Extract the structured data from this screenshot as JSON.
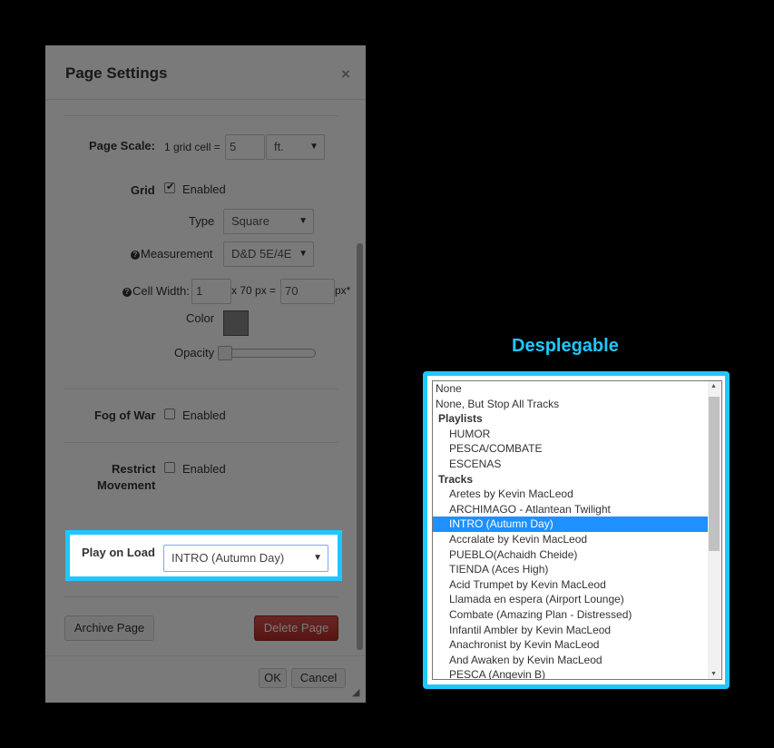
{
  "dialog": {
    "title": "Page Settings",
    "close": "×",
    "page_scale": {
      "label": "Page Scale:",
      "prefix": "1 grid cell =",
      "value": "5",
      "unit": "ft."
    },
    "grid": {
      "label": "Grid",
      "enabled_label": "Enabled",
      "enabled": true
    },
    "type": {
      "label": "Type",
      "value": "Square"
    },
    "measurement": {
      "label": "Measurement",
      "value": "D&D 5E/4E"
    },
    "cell_width": {
      "label": "Cell Width:",
      "value": "1",
      "mid": "x 70 px =",
      "px_value": "70",
      "unit": "px*"
    },
    "color": {
      "label": "Color",
      "value": "#888888"
    },
    "opacity": {
      "label": "Opacity",
      "level": 0.0
    },
    "fog_of_war": {
      "label": "Fog of War",
      "enabled_label": "Enabled",
      "enabled": false
    },
    "restrict_movement": {
      "label_1": "Restrict",
      "label_2": "Movement",
      "enabled_label": "Enabled",
      "enabled": false
    },
    "play_on_load": {
      "label": "Play on Load",
      "value": "INTRO (Autumn Day)"
    },
    "archive_button": "Archive Page",
    "delete_button": "Delete Page",
    "ok_button": "OK",
    "cancel_button": "Cancel"
  },
  "dropdown": {
    "heading": "Desplegable",
    "options": [
      {
        "label": "None",
        "kind": "option"
      },
      {
        "label": "None, But Stop All Tracks",
        "kind": "option"
      },
      {
        "label": "Playlists",
        "kind": "group"
      },
      {
        "label": "HUMOR",
        "kind": "item"
      },
      {
        "label": "PESCA/COMBATE",
        "kind": "item"
      },
      {
        "label": "ESCENAS",
        "kind": "item"
      },
      {
        "label": "Tracks",
        "kind": "group"
      },
      {
        "label": "Aretes by Kevin MacLeod",
        "kind": "item"
      },
      {
        "label": "ARCHIMAGO - Atlantean Twilight",
        "kind": "item"
      },
      {
        "label": "INTRO (Autumn Day)",
        "kind": "item",
        "selected": true
      },
      {
        "label": "Accralate by Kevin MacLeod",
        "kind": "item"
      },
      {
        "label": "PUEBLO(Achaidh Cheide)",
        "kind": "item"
      },
      {
        "label": "TIENDA (Aces High)",
        "kind": "item"
      },
      {
        "label": "Acid Trumpet by Kevin MacLeod",
        "kind": "item"
      },
      {
        "label": "Llamada en espera (Airport Lounge)",
        "kind": "item"
      },
      {
        "label": "Combate (Amazing Plan - Distressed)",
        "kind": "item"
      },
      {
        "label": "Infantil Ambler by Kevin MacLeod",
        "kind": "item"
      },
      {
        "label": "Anachronist by Kevin MacLeod",
        "kind": "item"
      },
      {
        "label": "And Awaken by Kevin MacLeod",
        "kind": "item"
      },
      {
        "label": "PESCA (Angevin B)",
        "kind": "item"
      }
    ]
  },
  "colors": {
    "highlight": "#1ec8ff",
    "selected": "#1e90ff",
    "delete": "#c9302c"
  }
}
